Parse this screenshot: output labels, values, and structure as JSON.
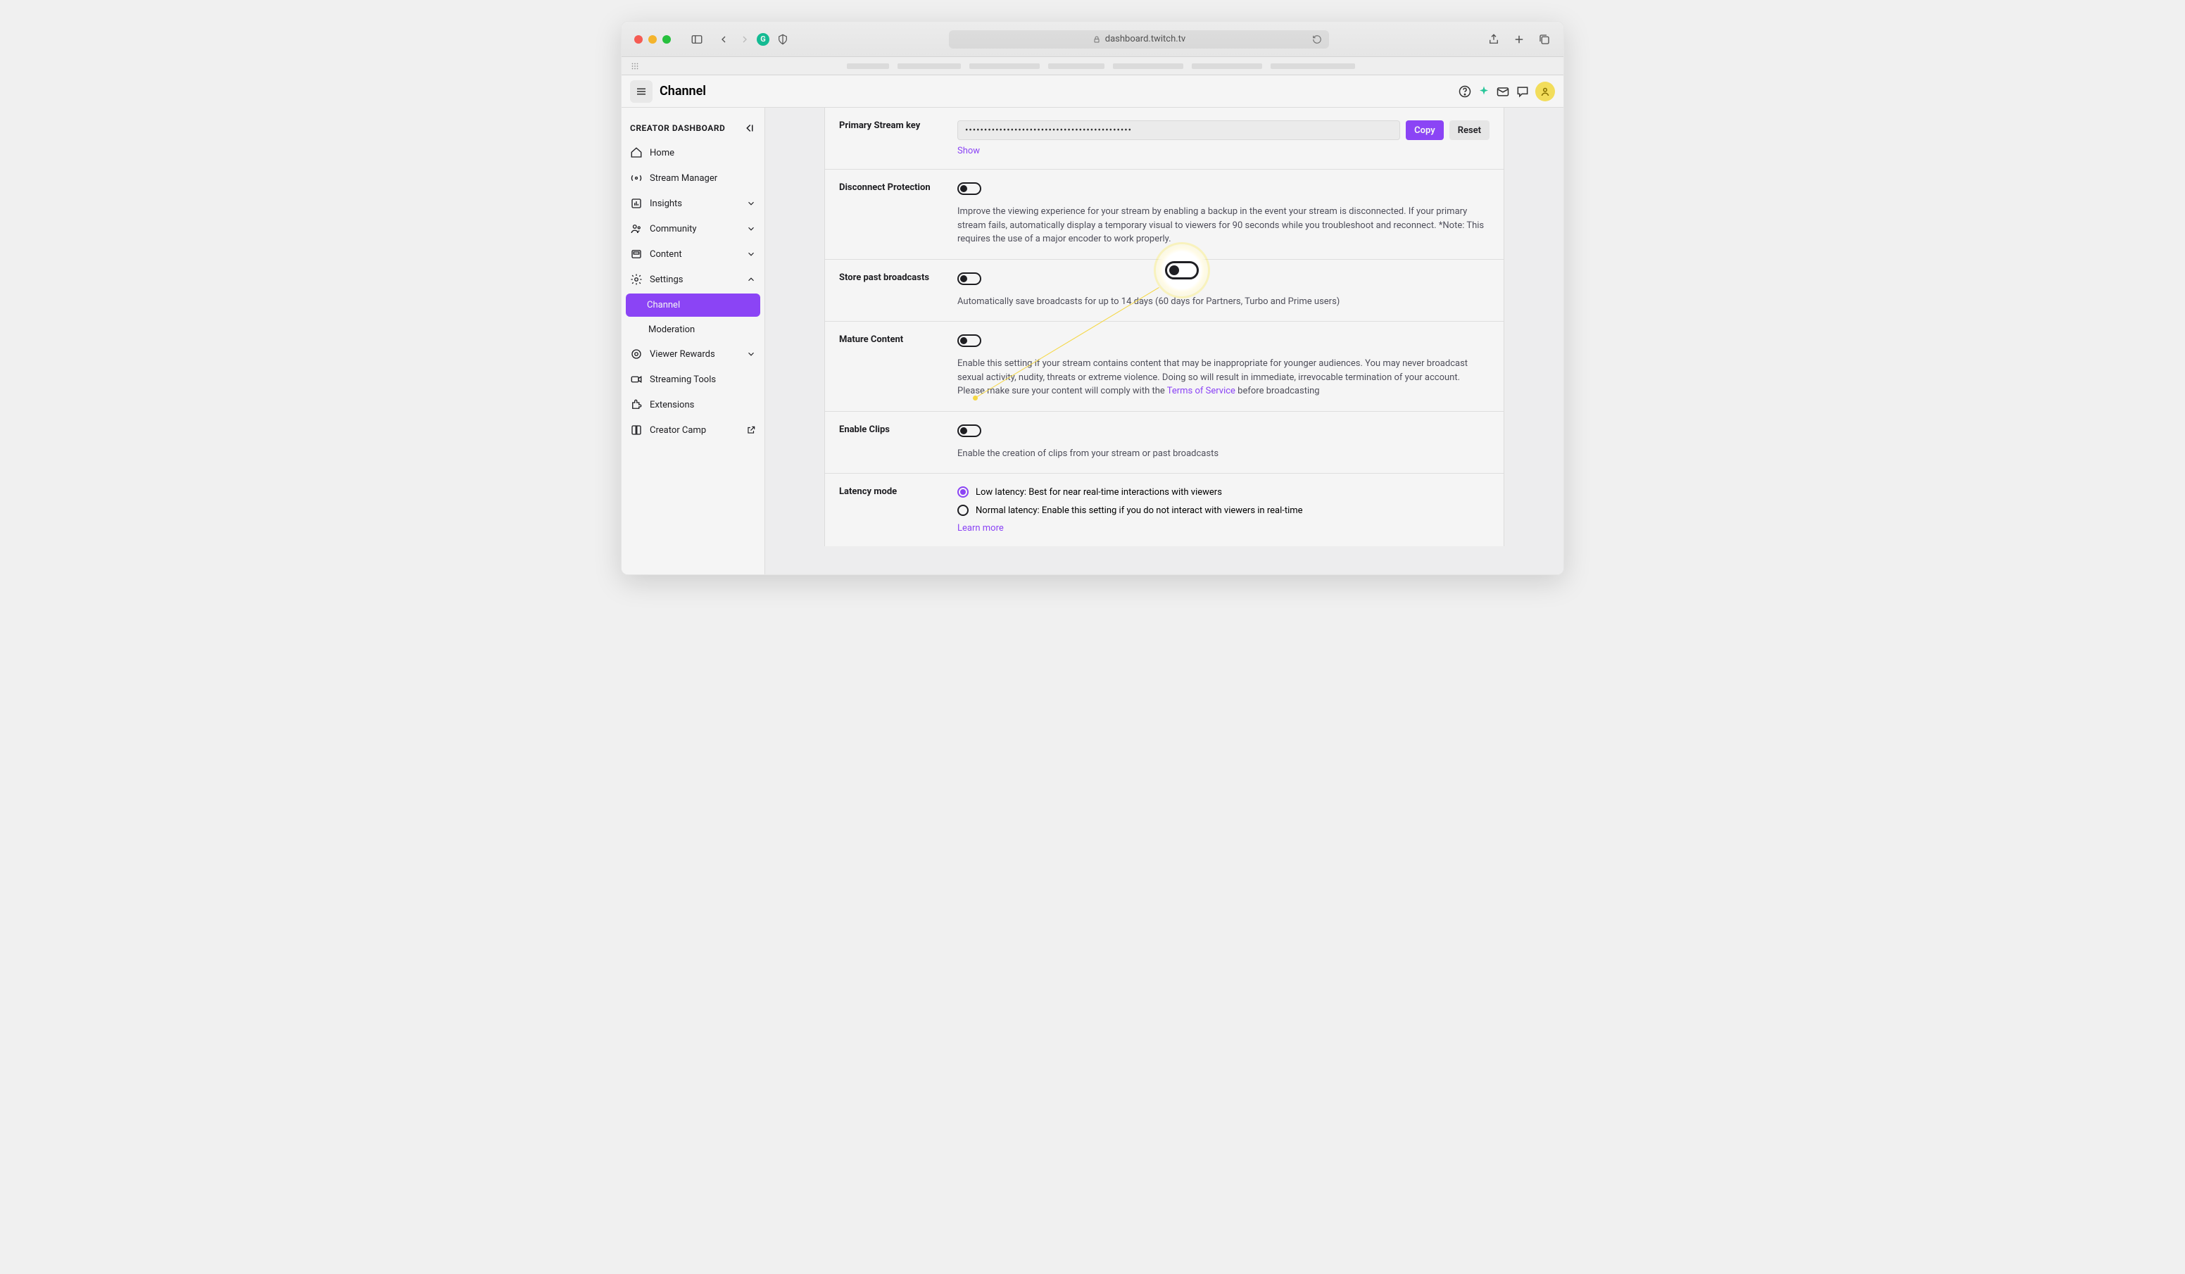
{
  "browser": {
    "url": "dashboard.twitch.tv"
  },
  "app": {
    "title": "Channel",
    "sidebar_header": "CREATOR DASHBOARD"
  },
  "sidebar": {
    "items": [
      {
        "label": "Home"
      },
      {
        "label": "Stream Manager"
      },
      {
        "label": "Insights"
      },
      {
        "label": "Community"
      },
      {
        "label": "Content"
      },
      {
        "label": "Settings"
      },
      {
        "label": "Channel"
      },
      {
        "label": "Moderation"
      },
      {
        "label": "Viewer Rewards"
      },
      {
        "label": "Streaming Tools"
      },
      {
        "label": "Extensions"
      },
      {
        "label": "Creator Camp"
      }
    ]
  },
  "settings": {
    "stream_key": {
      "label": "Primary Stream key",
      "value": "••••••••••••••••••••••••••••••••••••••••••••",
      "copy": "Copy",
      "reset": "Reset",
      "show": "Show"
    },
    "disconnect": {
      "label": "Disconnect Protection",
      "desc": "Improve the viewing experience for your stream by enabling a backup in the event your stream is disconnected. If your primary stream fails, automatically display a temporary visual to viewers for 90 seconds while you troubleshoot and reconnect. *Note: This requires the use of a major encoder to work properly."
    },
    "store": {
      "label": "Store past broadcasts",
      "desc": "Automatically save broadcasts for up to 14 days (60 days for Partners, Turbo and Prime users)"
    },
    "mature": {
      "label": "Mature Content",
      "desc_before": "Enable this setting if your stream contains content that may be inappropriate for younger audiences. You may never broadcast sexual activity, nudity, threats or extreme violence. Doing so will result in immediate, irrevocable termination of your account. Please make sure your content will comply with the ",
      "tos": "Terms of Service",
      "desc_after": " before broadcasting"
    },
    "clips": {
      "label": "Enable Clips",
      "desc": "Enable the creation of clips from your stream or past broadcasts"
    },
    "latency": {
      "label": "Latency mode",
      "low": "Low latency: Best for near real-time interactions with viewers",
      "normal": "Normal latency: Enable this setting if you do not interact with viewers in real-time",
      "learn": "Learn more"
    }
  }
}
